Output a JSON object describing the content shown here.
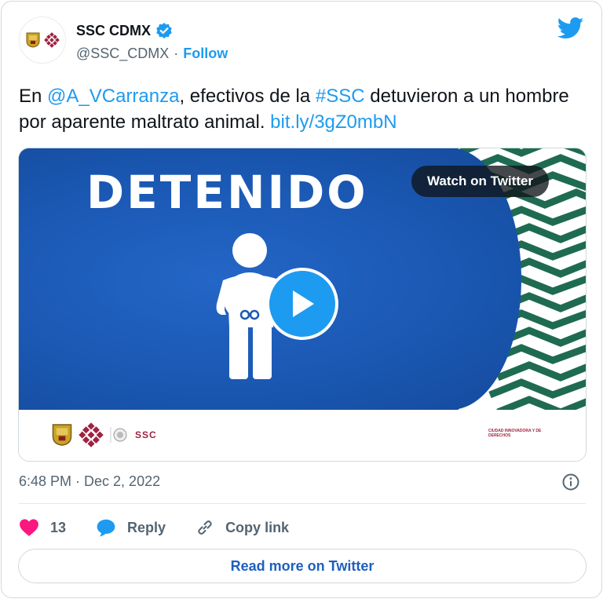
{
  "author": {
    "name": "SSC CDMX",
    "handle": "@SSC_CDMX",
    "separator": "·",
    "follow_label": "Follow",
    "verified_icon": "verified-badge-icon",
    "avatar_icons": [
      "coat-of-arms-icon",
      "cdmx-logo-icon"
    ]
  },
  "tweet": {
    "prefix": "En ",
    "mention": "@A_VCarranza",
    "middle": ", efectivos de la ",
    "hashtag": "#SSC",
    "suffix": " detuvieron a un hombre por aparente maltrato animal. ",
    "link": "bit.ly/3gZ0mbN"
  },
  "media": {
    "headline": "DETENIDO",
    "watch_label": "Watch on Twitter",
    "footer_brand": "SSC",
    "footer_tagline": "CIUDAD INNOVADORA Y DE DERECHOS"
  },
  "meta": {
    "timestamp": "6:48 PM · Dec 2, 2022"
  },
  "actions": {
    "like_count": "13",
    "reply_label": "Reply",
    "copy_label": "Copy link"
  },
  "read_more_label": "Read more on Twitter",
  "colors": {
    "accent": "#1d9bf0",
    "heart": "#f91880",
    "video_blue": "#1a58b3",
    "pattern_green": "#1f6b52",
    "cdmx_red": "#9f2241"
  }
}
